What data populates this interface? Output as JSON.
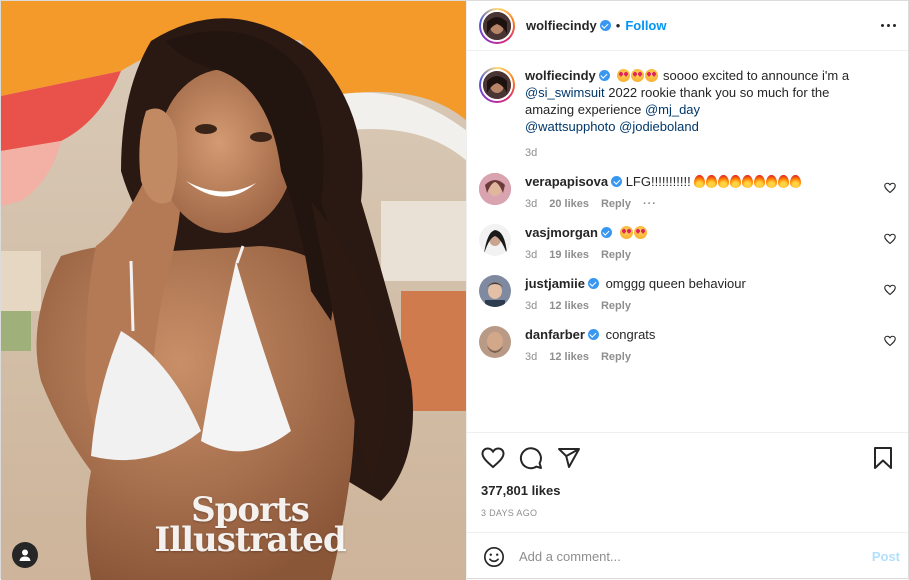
{
  "photo": {
    "brand_line1": "Sports",
    "brand_line2": "Illustrated",
    "tag_icon": "user-tag-icon"
  },
  "header": {
    "username": "wolfiecindy",
    "separator": "•",
    "follow_label": "Follow",
    "more_icon": "more-options-icon"
  },
  "caption": {
    "username": "wolfiecindy",
    "emojis": [
      "heart-eyes-emoji",
      "heart-eyes-emoji",
      "heart-eyes-emoji"
    ],
    "text_1": " soooo excited to announce i'm a ",
    "mention_1": "@si_swimsuit",
    "text_2": " 2022 rookie thank you so much for the amazing experience ",
    "mention_2": "@mj_day",
    "mention_3": "@wattsupphoto",
    "mention_4": "@jodieboland",
    "time": "3d"
  },
  "comments": [
    {
      "username": "verapapisova",
      "text": "LFG!!!!!!!!!!! ",
      "emoji": "fire-emoji",
      "emoji_count": 9,
      "time": "3d",
      "likes": "20 likes",
      "reply": "Reply",
      "has_more": true,
      "avatar_color": "#b07080"
    },
    {
      "username": "vasjmorgan",
      "text": "",
      "emoji": "heart-eyes-emoji",
      "emoji_count": 2,
      "time": "3d",
      "likes": "19 likes",
      "reply": "Reply",
      "has_more": false,
      "avatar_color": "#2a2a2a"
    },
    {
      "username": "justjamiie",
      "text": "omggg queen behaviour",
      "emoji": "",
      "emoji_count": 0,
      "time": "3d",
      "likes": "12 likes",
      "reply": "Reply",
      "has_more": false,
      "avatar_color": "#6b5b4f"
    },
    {
      "username": "danfarber",
      "text": "congrats",
      "emoji": "",
      "emoji_count": 0,
      "time": "3d",
      "likes": "12 likes",
      "reply": "Reply",
      "has_more": false,
      "avatar_color": "#8a6a5a"
    }
  ],
  "actions": {
    "like_icon": "heart-icon",
    "comment_icon": "comment-icon",
    "share_icon": "share-icon",
    "save_icon": "bookmark-icon",
    "likes": "377,801 likes",
    "date": "3 DAYS AGO"
  },
  "add_comment": {
    "emoji_icon": "emoji-icon",
    "placeholder": "Add a comment...",
    "post_label": "Post"
  },
  "colors": {
    "accent": "#0095f6",
    "verified": "#3897f0",
    "post_disabled": "#b2dffc",
    "muted": "#8e8e8e"
  }
}
